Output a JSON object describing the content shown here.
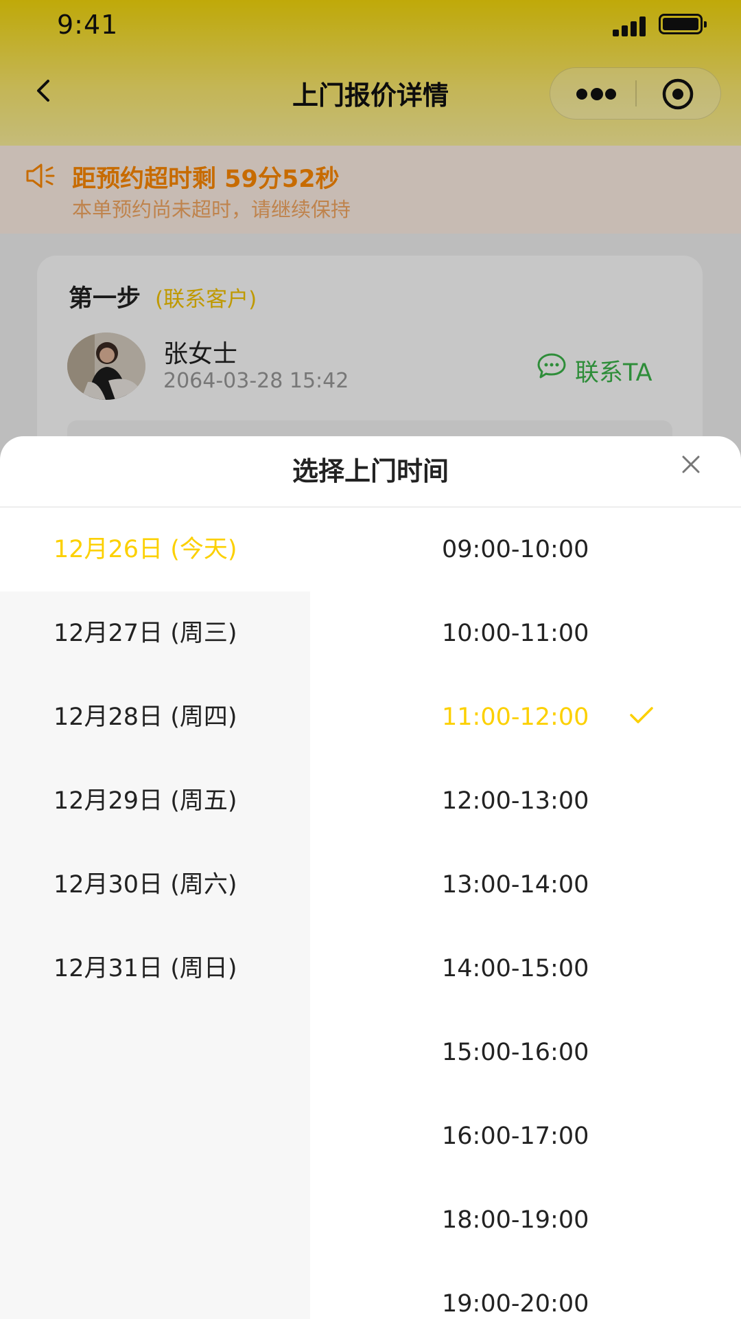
{
  "status_bar": {
    "time": "9:41"
  },
  "nav": {
    "title": "上门报价详情"
  },
  "countdown": {
    "title": "距预约超时剩 59分52秒",
    "subtitle": "本单预约尚未超时，请继续保持"
  },
  "step": {
    "title": "第一步",
    "hint": "(联系客户)",
    "customer_name": "张女士",
    "customer_time": "2064-03-28 15:42",
    "contact_label": "联系TA"
  },
  "sheet": {
    "title": "选择上门时间",
    "dates": [
      {
        "label": "12月26日 (今天)",
        "selected": true
      },
      {
        "label": "12月27日 (周三)",
        "selected": false
      },
      {
        "label": "12月28日 (周四)",
        "selected": false
      },
      {
        "label": "12月29日 (周五)",
        "selected": false
      },
      {
        "label": "12月30日 (周六)",
        "selected": false
      },
      {
        "label": "12月31日 (周日)",
        "selected": false
      }
    ],
    "times": [
      {
        "label": "09:00-10:00",
        "selected": false
      },
      {
        "label": "10:00-11:00",
        "selected": false
      },
      {
        "label": "11:00-12:00",
        "selected": true
      },
      {
        "label": "12:00-13:00",
        "selected": false
      },
      {
        "label": "13:00-14:00",
        "selected": false
      },
      {
        "label": "14:00-15:00",
        "selected": false
      },
      {
        "label": "15:00-16:00",
        "selected": false
      },
      {
        "label": "16:00-17:00",
        "selected": false
      },
      {
        "label": "18:00-19:00",
        "selected": false
      },
      {
        "label": "19:00-20:00",
        "selected": false
      }
    ]
  },
  "colors": {
    "accent": "#fcd000",
    "countdown_text": "#ff8a00",
    "contact_green": "#3bb54a",
    "header_yellow": "#f6d90c"
  },
  "icons": [
    "signal-icon",
    "battery-icon",
    "back-icon",
    "more-icon",
    "mini-program-close-icon",
    "speaker-icon",
    "chat-icon",
    "close-icon",
    "check-icon"
  ]
}
